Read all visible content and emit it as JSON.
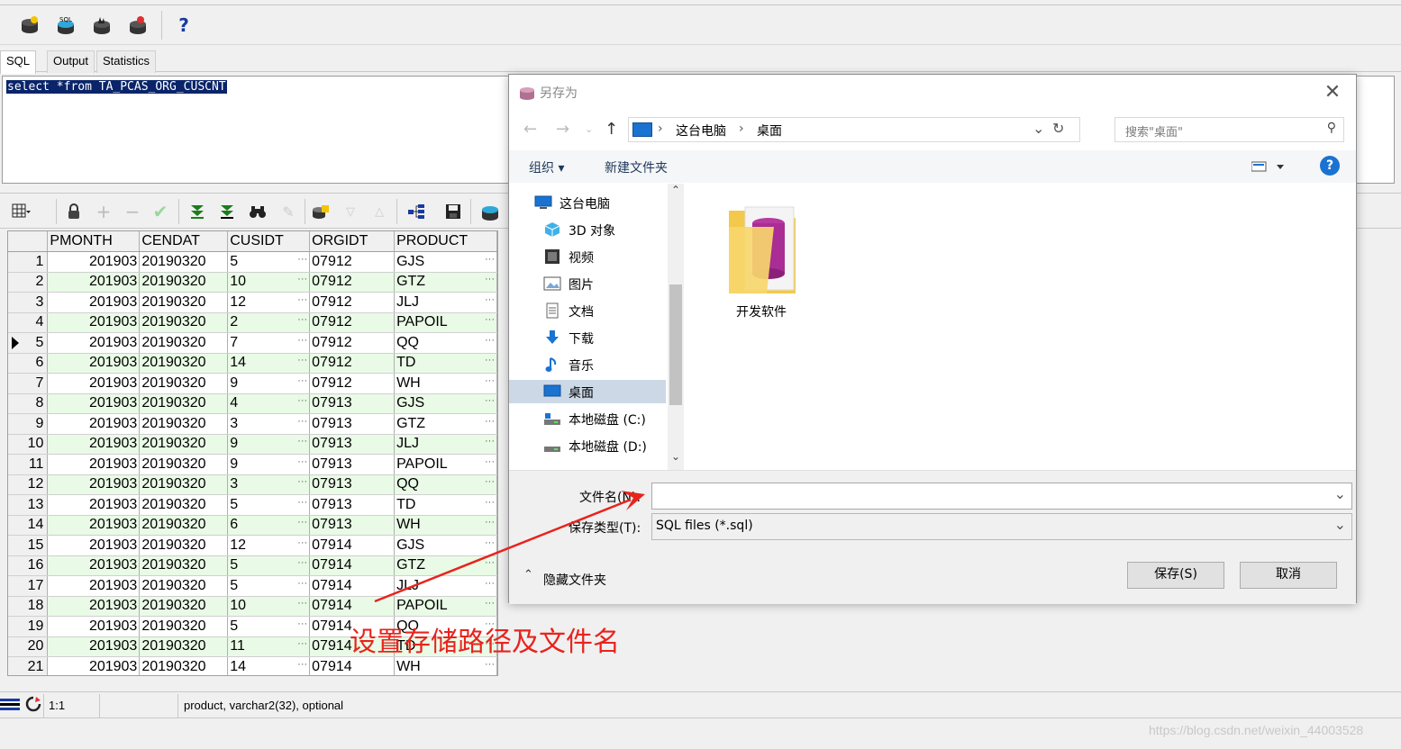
{
  "tabs": [
    "SQL",
    "Output",
    "Statistics"
  ],
  "sql": "select *from TA_PCAS_ORG_CUSCNT",
  "grid": {
    "columns": [
      "PMONTH",
      "CENDAT",
      "CUSIDT",
      "ORGIDT",
      "PRODUCT"
    ],
    "rows": [
      [
        "1",
        "201903",
        "20190320",
        "5",
        "07912",
        "GJS"
      ],
      [
        "2",
        "201903",
        "20190320",
        "10",
        "07912",
        "GTZ"
      ],
      [
        "3",
        "201903",
        "20190320",
        "12",
        "07912",
        "JLJ"
      ],
      [
        "4",
        "201903",
        "20190320",
        "2",
        "07912",
        "PAPOIL"
      ],
      [
        "5",
        "201903",
        "20190320",
        "7",
        "07912",
        "QQ"
      ],
      [
        "6",
        "201903",
        "20190320",
        "14",
        "07912",
        "TD"
      ],
      [
        "7",
        "201903",
        "20190320",
        "9",
        "07912",
        "WH"
      ],
      [
        "8",
        "201903",
        "20190320",
        "4",
        "07913",
        "GJS"
      ],
      [
        "9",
        "201903",
        "20190320",
        "3",
        "07913",
        "GTZ"
      ],
      [
        "10",
        "201903",
        "20190320",
        "9",
        "07913",
        "JLJ"
      ],
      [
        "11",
        "201903",
        "20190320",
        "9",
        "07913",
        "PAPOIL"
      ],
      [
        "12",
        "201903",
        "20190320",
        "3",
        "07913",
        "QQ"
      ],
      [
        "13",
        "201903",
        "20190320",
        "5",
        "07913",
        "TD"
      ],
      [
        "14",
        "201903",
        "20190320",
        "6",
        "07913",
        "WH"
      ],
      [
        "15",
        "201903",
        "20190320",
        "12",
        "07914",
        "GJS"
      ],
      [
        "16",
        "201903",
        "20190320",
        "5",
        "07914",
        "GTZ"
      ],
      [
        "17",
        "201903",
        "20190320",
        "5",
        "07914",
        "JLJ"
      ],
      [
        "18",
        "201903",
        "20190320",
        "10",
        "07914",
        "PAPOIL"
      ],
      [
        "19",
        "201903",
        "20190320",
        "5",
        "07914",
        "QQ"
      ],
      [
        "20",
        "201903",
        "20190320",
        "11",
        "07914",
        "TD"
      ],
      [
        "21",
        "201903",
        "20190320",
        "14",
        "07914",
        "WH"
      ]
    ],
    "current_row": "5"
  },
  "status": {
    "position": "1:1",
    "field_info": "product, varchar2(32), optional"
  },
  "dialog": {
    "title": "另存为",
    "breadcrumb": [
      "这台电脑",
      "桌面"
    ],
    "search_placeholder": "搜索\"桌面\"",
    "organize": "组织 ▾",
    "new_folder": "新建文件夹",
    "nav_items": [
      {
        "label": "这台电脑",
        "icon": "pc-icon"
      },
      {
        "label": "3D 对象",
        "icon": "cube-icon"
      },
      {
        "label": "视频",
        "icon": "video-icon"
      },
      {
        "label": "图片",
        "icon": "picture-icon"
      },
      {
        "label": "文档",
        "icon": "document-icon"
      },
      {
        "label": "下载",
        "icon": "download-icon"
      },
      {
        "label": "音乐",
        "icon": "music-icon"
      },
      {
        "label": "桌面",
        "icon": "desktop-icon"
      },
      {
        "label": "本地磁盘 (C:)",
        "icon": "drive-c-icon"
      },
      {
        "label": "本地磁盘 (D:)",
        "icon": "drive-d-icon"
      }
    ],
    "selected_nav": "桌面",
    "folder_name": "开发软件",
    "filename_label": "文件名(N):",
    "filename_value": "",
    "filetype_label": "保存类型(T):",
    "filetype_value": "SQL files (*.sql)",
    "hide_folders": "隐藏文件夹",
    "save_button": "保存(S)",
    "cancel_button": "取消"
  },
  "annotation": "设置存储路径及文件名",
  "watermark": "https://blog.csdn.net/weixin_44003528",
  "colors": {
    "selection": "#0a246a",
    "grid_alt_row": "#e9fbe6",
    "annotation": "#e8231d",
    "nav_selected": "#ccd8e6"
  }
}
